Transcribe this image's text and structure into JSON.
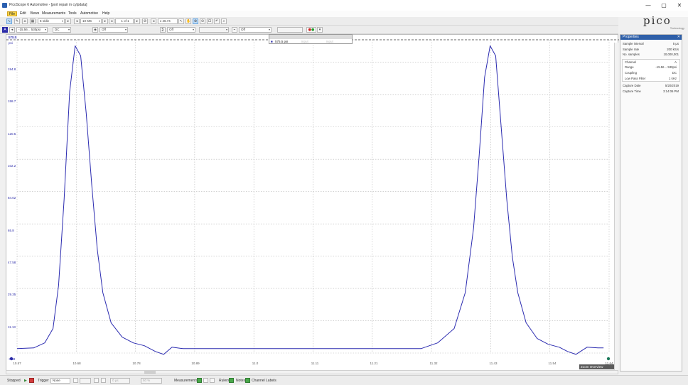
{
  "window": {
    "title": "PicoScope 6 Automotive - [port repair in cylpdata]",
    "minimize_glyph": "—",
    "maximize_glyph": "▢",
    "close_glyph": "✕"
  },
  "logo": {
    "name": "pico",
    "subtitle": "Technology"
  },
  "menu": [
    "File",
    "Edit",
    "Views",
    "Measurements",
    "Tools",
    "Automotive",
    "Help"
  ],
  "toolbar1": {
    "timebase": "5 s/div",
    "samples": "10 MS",
    "buffer_position": "1 of 1",
    "zoom": "x 46.74"
  },
  "toolbar2": {
    "channel": "A",
    "range": "-15.56 .. 530psi",
    "coupling": "DC",
    "filter": "Off",
    "math": "Off",
    "trigger_source": "Off"
  },
  "measurement_table": {
    "row_value": "575.5 psi",
    "placeholder1": "input",
    "placeholder2": "input"
  },
  "scope": {
    "ruler_badge": "575.5",
    "unit": "psi"
  },
  "chart_data": {
    "type": "line",
    "xlabel": "",
    "ylabel": "psi",
    "xlim": [
      10.57,
      11.64
    ],
    "ylim": [
      -7.08,
      211.2
    ],
    "yticks": [
      "194.8",
      "158.7",
      "120.5",
      "102.2",
      "84.02",
      "65.8",
      "47.58",
      "29.35",
      "11.13",
      "-7.08"
    ],
    "xticks": [
      "10.57",
      "10.68",
      "10.78",
      "10.89",
      "11.0",
      "11.11",
      "11.21",
      "11.32",
      "11.43",
      "11.54",
      "11.64"
    ],
    "grid": true,
    "series": [
      {
        "color": "#2b2bb0",
        "x": [
          10.57,
          10.6,
          10.62,
          10.635,
          10.645,
          10.655,
          10.665,
          10.675,
          10.685,
          10.695,
          10.705,
          10.715,
          10.725,
          10.74,
          10.76,
          10.78,
          10.8,
          10.82,
          10.835,
          10.85,
          10.87,
          10.9,
          10.95,
          11.0,
          11.1,
          11.2,
          11.3,
          11.33,
          11.36,
          11.38,
          11.395,
          11.405,
          11.415,
          11.425,
          11.435,
          11.445,
          11.455,
          11.465,
          11.475,
          11.49,
          11.51,
          11.53,
          11.55,
          11.565,
          11.58,
          11.6,
          11.62,
          11.63
        ],
        "y": [
          -4,
          -3.5,
          0,
          10,
          40,
          100,
          175,
          207,
          200,
          160,
          110,
          65,
          35,
          14,
          4,
          0,
          -2,
          -6,
          -8,
          -3,
          -4,
          -4,
          -4,
          -4,
          -4,
          -4,
          -4,
          0,
          10,
          35,
          80,
          130,
          185,
          207,
          200,
          150,
          100,
          60,
          35,
          14,
          3,
          -1,
          -3,
          -6,
          -8,
          -3,
          -3.5,
          -3.5
        ]
      }
    ]
  },
  "zoom_overview_label": "Zoom Overview",
  "properties": {
    "title": "Properties",
    "close_glyph": "✕",
    "general": [
      {
        "label": "Sample interval",
        "value": "5 µs"
      },
      {
        "label": "Sample rate",
        "value": "200 kS/s"
      },
      {
        "label": "No. samples",
        "value": "10,000,001"
      }
    ],
    "channel": [
      {
        "label": "Channel",
        "value": "A"
      },
      {
        "label": "Range",
        "value": "-15.56 .. 530psi"
      },
      {
        "label": "Coupling",
        "value": "DC"
      },
      {
        "label": "Low Pass Filter",
        "value": "1 kHz"
      }
    ],
    "capture": [
      {
        "label": "Capture Date",
        "value": "5/20/2019"
      },
      {
        "label": "Capture Time",
        "value": "3:14:06 PM"
      }
    ]
  },
  "status": {
    "state": "Stopped",
    "trigger_label": "Trigger",
    "trigger_mode": "None",
    "trigger_level": "0 µs",
    "pretrigger": "50 %",
    "measurements": "Measurements",
    "rulers": "Rulers",
    "notes": "Notes",
    "channel_labels": "Channel Labels"
  }
}
